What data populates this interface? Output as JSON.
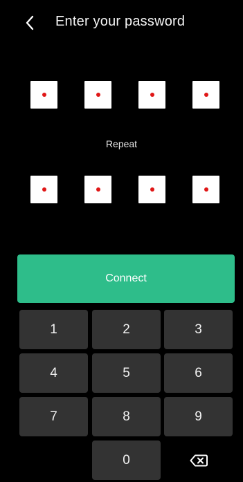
{
  "header": {
    "title": "Enter your password",
    "back_icon": "chevron-left-icon"
  },
  "pin": {
    "first": [
      "•",
      "•",
      "•",
      "•"
    ],
    "repeat_label": "Repeat",
    "second": [
      "•",
      "•",
      "•",
      "•"
    ],
    "dot_color": "#e01717"
  },
  "connect_button": {
    "label": "Connect",
    "color": "#2ebd8a"
  },
  "keypad": {
    "keys": [
      "1",
      "2",
      "3",
      "4",
      "5",
      "6",
      "7",
      "8",
      "9",
      "0"
    ],
    "backspace_icon": "backspace-icon",
    "key_color": "#333333"
  }
}
